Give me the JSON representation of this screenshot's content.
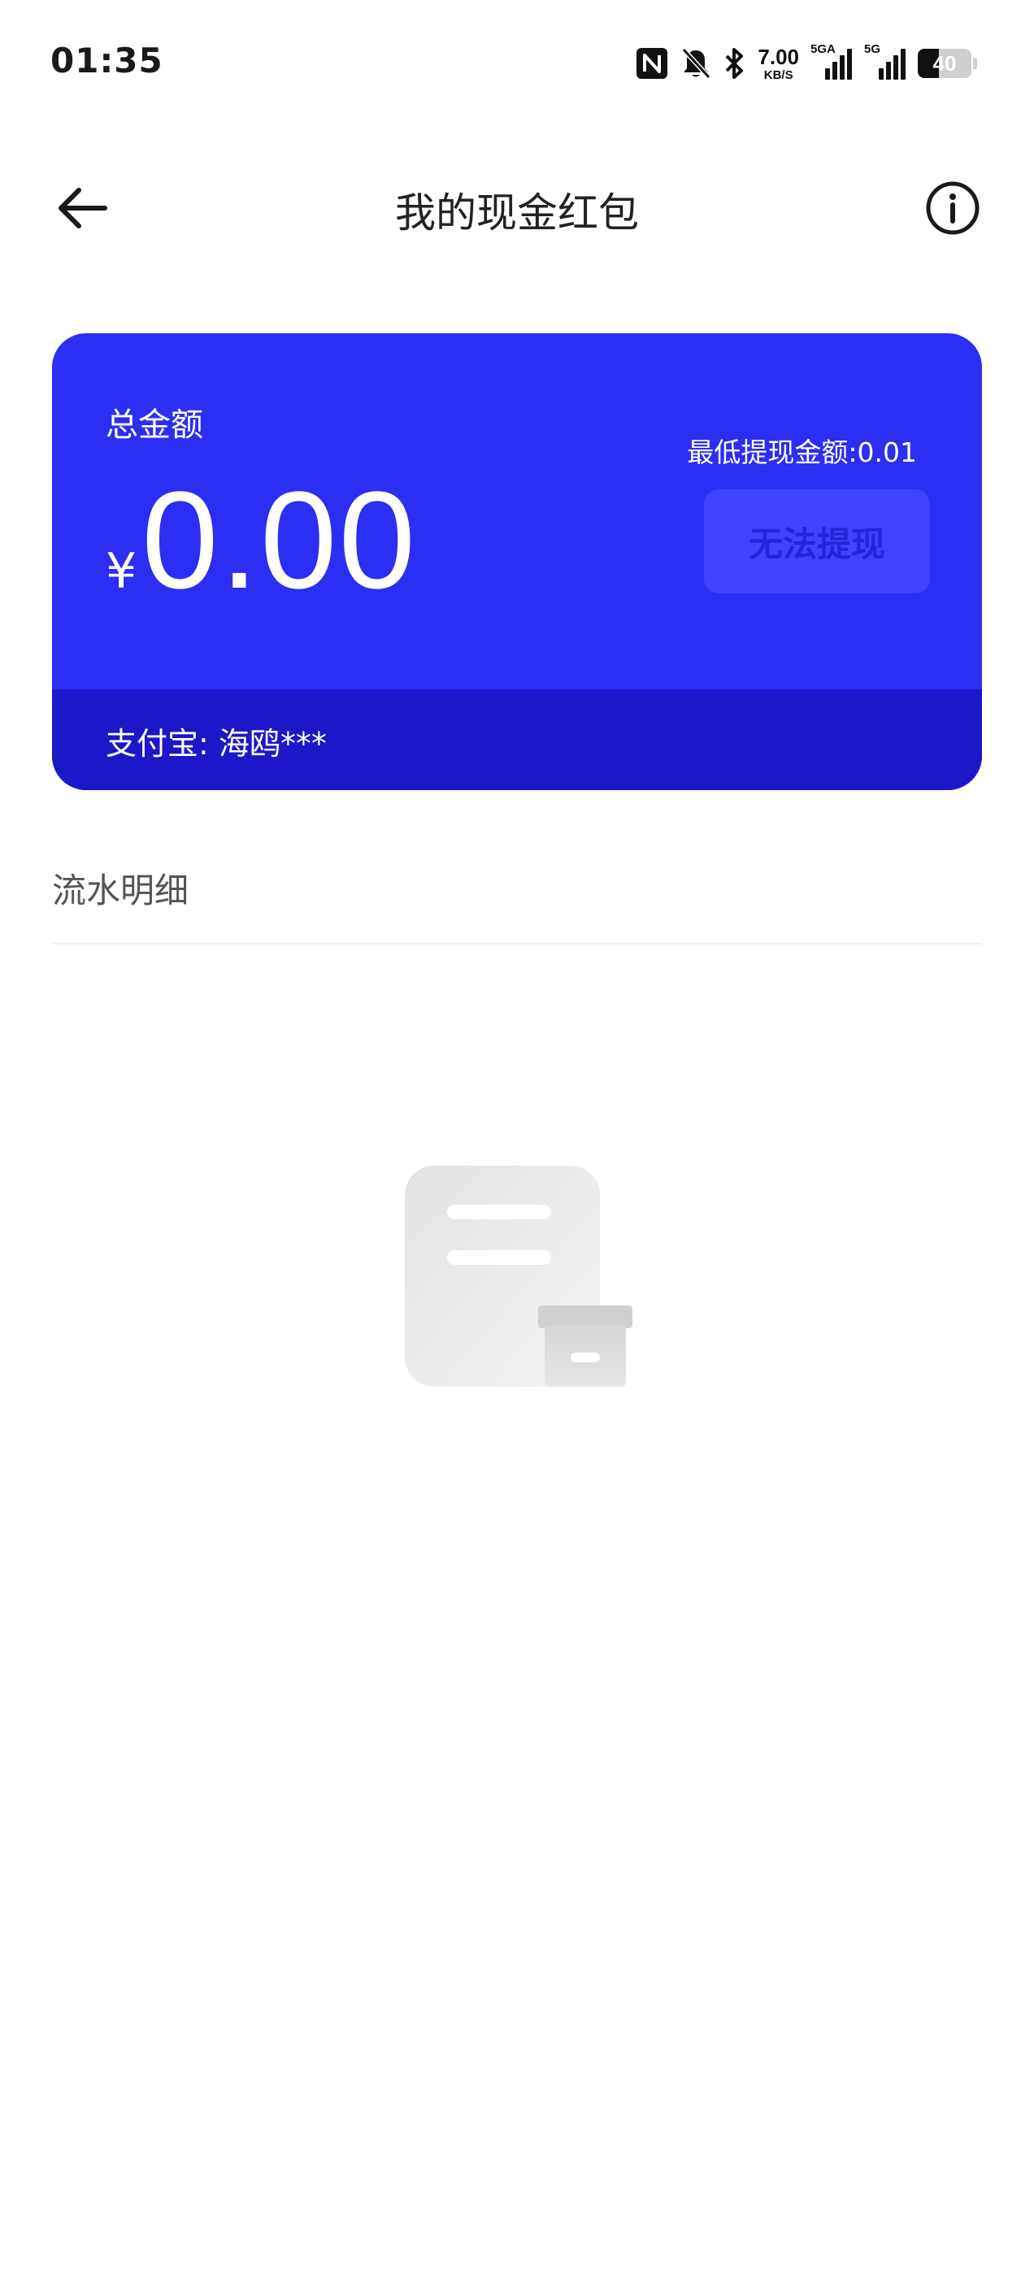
{
  "status_bar": {
    "time": "01:35",
    "net_speed_value": "7.00",
    "net_speed_unit": "KB/S",
    "sim1_tag": "5GA",
    "sim2_tag": "5G",
    "battery_level": "40",
    "icons": [
      "nfc-icon",
      "mute-bell-icon",
      "bluetooth-icon",
      "signal-icon",
      "signal-icon",
      "battery-icon"
    ]
  },
  "header": {
    "title": "我的现金红包",
    "back_icon": "back-arrow-icon",
    "info_icon": "info-icon"
  },
  "card": {
    "total_label": "总金额",
    "currency_symbol": "¥",
    "amount": "0.00",
    "min_withdraw": "最低提现金额:0.01",
    "withdraw_button": "无法提现",
    "account": "支付宝: 海鸥***",
    "colors": {
      "card": "#2b2ef3",
      "card_bottom": "#1c17c9",
      "button_bg": "#4243ff",
      "button_text": "#2325d8"
    }
  },
  "transactions": {
    "title": "流水明细",
    "empty_icon": "empty-document-box-icon"
  }
}
